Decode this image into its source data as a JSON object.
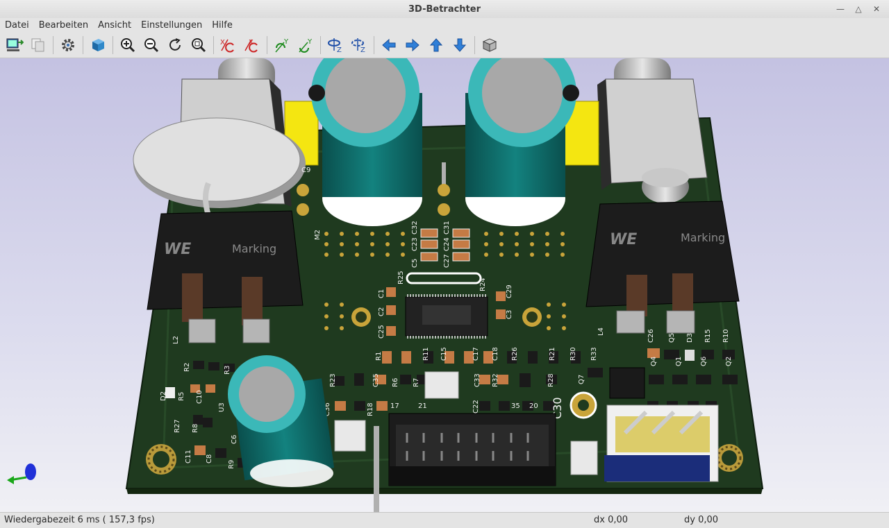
{
  "window": {
    "title": "3D-Betrachter"
  },
  "menu": [
    "Datei",
    "Bearbeiten",
    "Ansicht",
    "Einstellungen",
    "Hilfe"
  ],
  "toolbar": [
    {
      "name": "copy-3d-image-icon"
    },
    {
      "name": "copy-to-clipboard-icon"
    },
    {
      "name": "preferences-gear-icon"
    },
    {
      "name": "raytracing-cube-icon"
    },
    {
      "name": "zoom-in-icon"
    },
    {
      "name": "zoom-out-icon"
    },
    {
      "name": "redraw-icon"
    },
    {
      "name": "zoom-fit-icon"
    },
    {
      "name": "rotate-x-cw-icon"
    },
    {
      "name": "rotate-x-ccw-icon"
    },
    {
      "name": "rotate-y-cw-icon"
    },
    {
      "name": "rotate-y-ccw-icon"
    },
    {
      "name": "rotate-z-cw-icon"
    },
    {
      "name": "rotate-z-ccw-icon"
    },
    {
      "name": "pan-left-icon"
    },
    {
      "name": "pan-right-icon"
    },
    {
      "name": "pan-up-icon"
    },
    {
      "name": "pan-down-icon"
    },
    {
      "name": "ortho-projection-icon"
    }
  ],
  "board": {
    "labels": [
      "C9",
      "M2",
      "C5",
      "C23",
      "C32",
      "C27",
      "C24",
      "C31",
      "R25",
      "R24",
      "C29",
      "C1",
      "C2",
      "C3",
      "C25",
      "L2",
      "L4",
      "R1",
      "R11",
      "C15",
      "C17",
      "C18",
      "R26",
      "R21",
      "R30",
      "R33",
      "C26",
      "Q5",
      "D3",
      "R15",
      "R10",
      "R2",
      "R3",
      "R23",
      "C35",
      "R6",
      "R7",
      "C33",
      "R32",
      "R28",
      "Q7",
      "Q4",
      "Q1",
      "Q6",
      "Q2",
      "D2",
      "R5",
      "C10",
      "U3",
      "C36",
      "R18",
      "C22",
      "C30",
      "R27",
      "R8",
      "C11",
      "C8",
      "R9",
      "C6",
      "17",
      "21",
      "35",
      "20",
      "Marking",
      "Marking"
    ],
    "brand_marks": [
      "WE",
      "WE"
    ]
  },
  "status": {
    "render_time": "Wiedergabezeit 6 ms ( 157,3 fps)",
    "dx": "dx 0,00",
    "dy": "dy 0,00"
  },
  "colors": {
    "pcb": "#1f3a1f",
    "capacitor": "#0f6b68",
    "cap_band": "#3bb8b8",
    "inductor": "#1c1c1c",
    "connector_yellow": "#f4e611",
    "viewport_top": "#c4c2e2"
  }
}
